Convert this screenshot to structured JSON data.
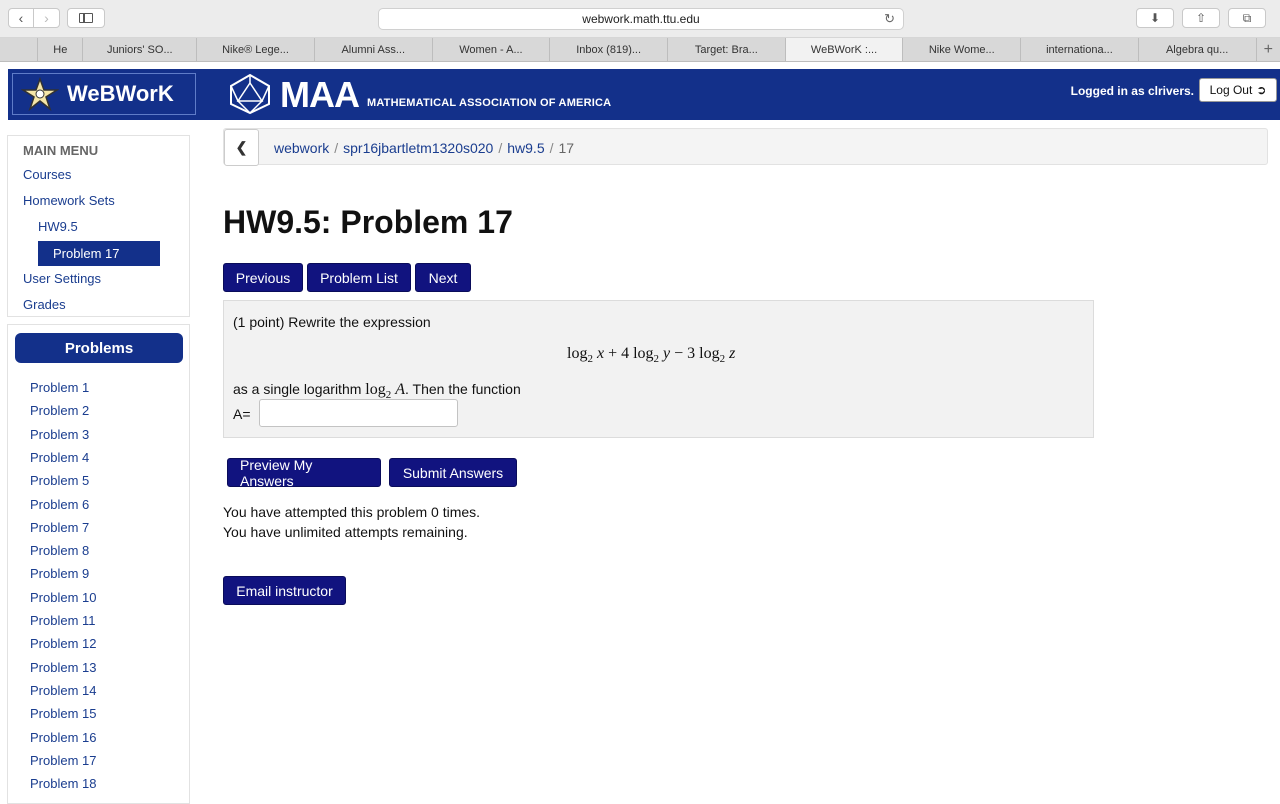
{
  "browser": {
    "url": "webwork.math.ttu.edu",
    "tabs": [
      {
        "label": "He",
        "width": 46
      },
      {
        "label": "Juniors' SO...",
        "width": 116
      },
      {
        "label": "Nike® Lege...",
        "width": 120
      },
      {
        "label": "Alumni Ass...",
        "width": 120
      },
      {
        "label": "Women - A...",
        "width": 120
      },
      {
        "label": "Inbox (819)...",
        "width": 120
      },
      {
        "label": "Target: Bra...",
        "width": 120
      },
      {
        "label": "WeBWorK :...",
        "width": 120,
        "active": true
      },
      {
        "label": "Nike Wome...",
        "width": 120
      },
      {
        "label": "internationa...",
        "width": 120
      },
      {
        "label": "Algebra qu...",
        "width": 120
      }
    ]
  },
  "header": {
    "logo_text": "WeBWorK",
    "maa_text": "MAA",
    "maa_sub": "MATHEMATICAL ASSOCIATION OF AMERICA",
    "login_status": "Logged in as clrivers.",
    "logout_label": "Log Out"
  },
  "menu": {
    "heading": "MAIN MENU",
    "courses": "Courses",
    "homework_sets": "Homework Sets",
    "hw_set": "HW9.5",
    "active_problem": "Problem 17",
    "user_settings": "User Settings",
    "grades": "Grades"
  },
  "problems_panel": {
    "title": "Problems",
    "items": [
      "Problem 1",
      "Problem 2",
      "Problem 3",
      "Problem 4",
      "Problem 5",
      "Problem 6",
      "Problem 7",
      "Problem 8",
      "Problem 9",
      "Problem 10",
      "Problem 11",
      "Problem 12",
      "Problem 13",
      "Problem 14",
      "Problem 15",
      "Problem 16",
      "Problem 17",
      "Problem 18"
    ]
  },
  "breadcrumb": {
    "c1": "webwork",
    "c2": "spr16jbartletm1320s020",
    "c3": "hw9.5",
    "c4": "17"
  },
  "page_title": "HW9.5: Problem 17",
  "nav": {
    "previous": "Previous",
    "problem_list": "Problem List",
    "next": "Next"
  },
  "problem": {
    "intro": "(1 point) Rewrite the expression",
    "as_single": "as a single logarithm",
    "then_function": ". Then the function",
    "answer_label": "A=",
    "answer_value": ""
  },
  "actions": {
    "preview": "Preview My Answers",
    "submit": "Submit Answers",
    "email": "Email instructor"
  },
  "status": {
    "attempted": "You have attempted this problem 0 times.",
    "remaining": "You have unlimited attempts remaining."
  }
}
